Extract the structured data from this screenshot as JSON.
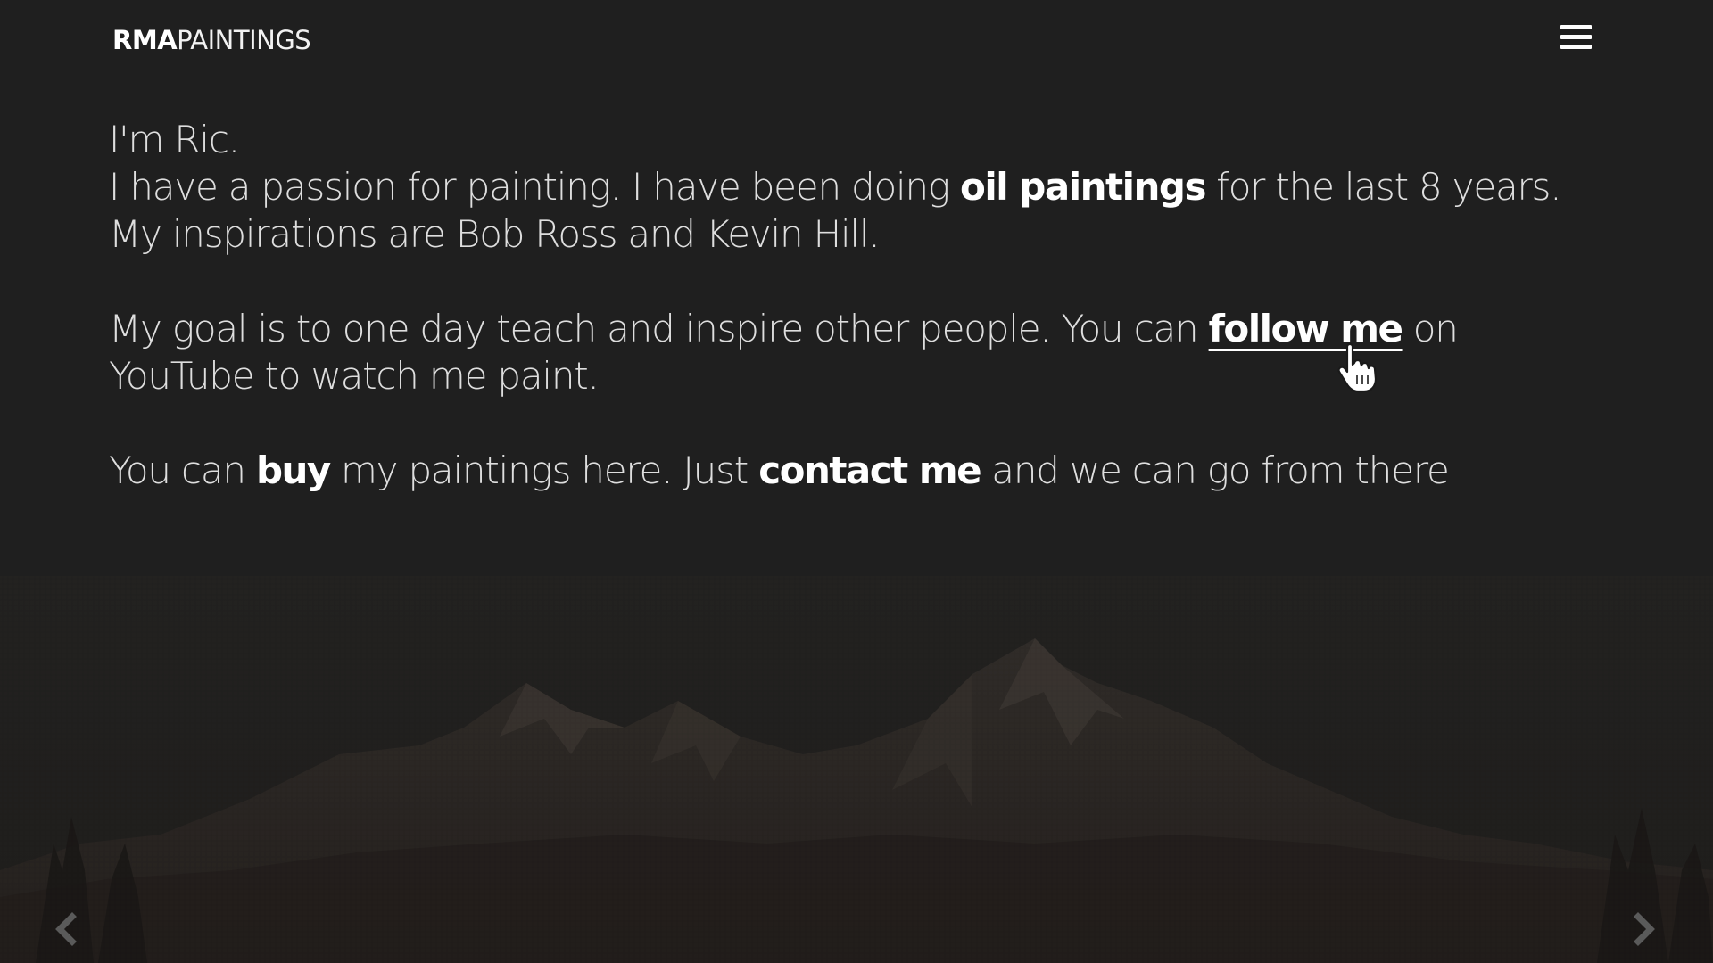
{
  "header": {
    "logo_bold": "RMA",
    "logo_light": "PAINTINGS"
  },
  "intro": {
    "line1": "I'm Ric.",
    "line2_a": "I have a passion for painting. I have been doing ",
    "line2_bold": "oil paintings",
    "line2_b": " for the last 8 years.",
    "line3": "My inspirations are Bob Ross and Kevin Hill.",
    "para2_a": "My goal is to one day teach and inspire other people. You can ",
    "para2_link": "follow me",
    "para2_b": " on YouTube to watch me paint.",
    "para3_a": "You can ",
    "para3_link1": "buy",
    "para3_b": " my paintings here. Just ",
    "para3_link2": "contact me",
    "para3_c": " and we can go from there"
  },
  "icons": {
    "menu": "hamburger-menu-icon",
    "cursor": "hand-pointer-cursor-icon",
    "prev": "chevron-left-icon",
    "next": "chevron-right-icon"
  },
  "colors": {
    "background": "#1f1f1f",
    "text": "#dedede",
    "emphasis": "#ffffff"
  }
}
